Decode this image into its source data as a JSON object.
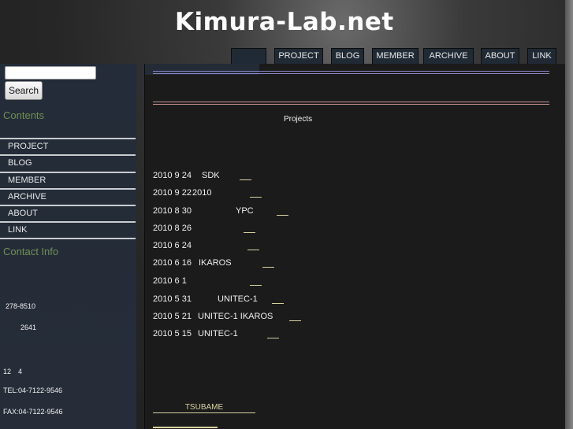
{
  "header": {
    "title": "Kimura-Lab.net"
  },
  "nav": {
    "tabs": [
      "",
      "PROJECT",
      "BLOG",
      "MEMBER",
      "ARCHIVE",
      "ABOUT",
      "LINK"
    ]
  },
  "sidebar": {
    "search_button": "Search",
    "search_placeholder": "",
    "contents_heading": "Contents",
    "items": [
      "PROJECT",
      "BLOG",
      "MEMBER",
      "ARCHIVE",
      "ABOUT",
      "LINK"
    ],
    "contact_heading": "Contact Info",
    "contact": {
      "postal": "278-8510",
      "address": "2641",
      "floor": "12　4",
      "tel": "TEL:04-7122-9546",
      "fax": "FAX:04-7122-9546"
    }
  },
  "main": {
    "section_label": "Projects",
    "entries": [
      {
        "date": "2010 9 24",
        "title": "SDK"
      },
      {
        "date": "2010 9 22",
        "title": "2010"
      },
      {
        "date": "2010 8 30",
        "title": "YPC"
      },
      {
        "date": "2010 8 26",
        "title": ""
      },
      {
        "date": "2010 6 24",
        "title": ""
      },
      {
        "date": "2010 6 16",
        "title": "IKAROS"
      },
      {
        "date": "2010 6 1",
        "title": ""
      },
      {
        "date": "2010 5 31",
        "title": "UNITEC-1"
      },
      {
        "date": "2010 5 21",
        "title": "UNITEC-1 IKAROS"
      },
      {
        "date": "2010 5 15",
        "title": "UNITEC-1"
      }
    ],
    "footer_link": "TSUBAME"
  },
  "colors": {
    "accent_green": "#6f8f55",
    "link_underline": "#d8d2a0",
    "rule_blue": "#8a86c8",
    "rule_red": "#c89090"
  }
}
